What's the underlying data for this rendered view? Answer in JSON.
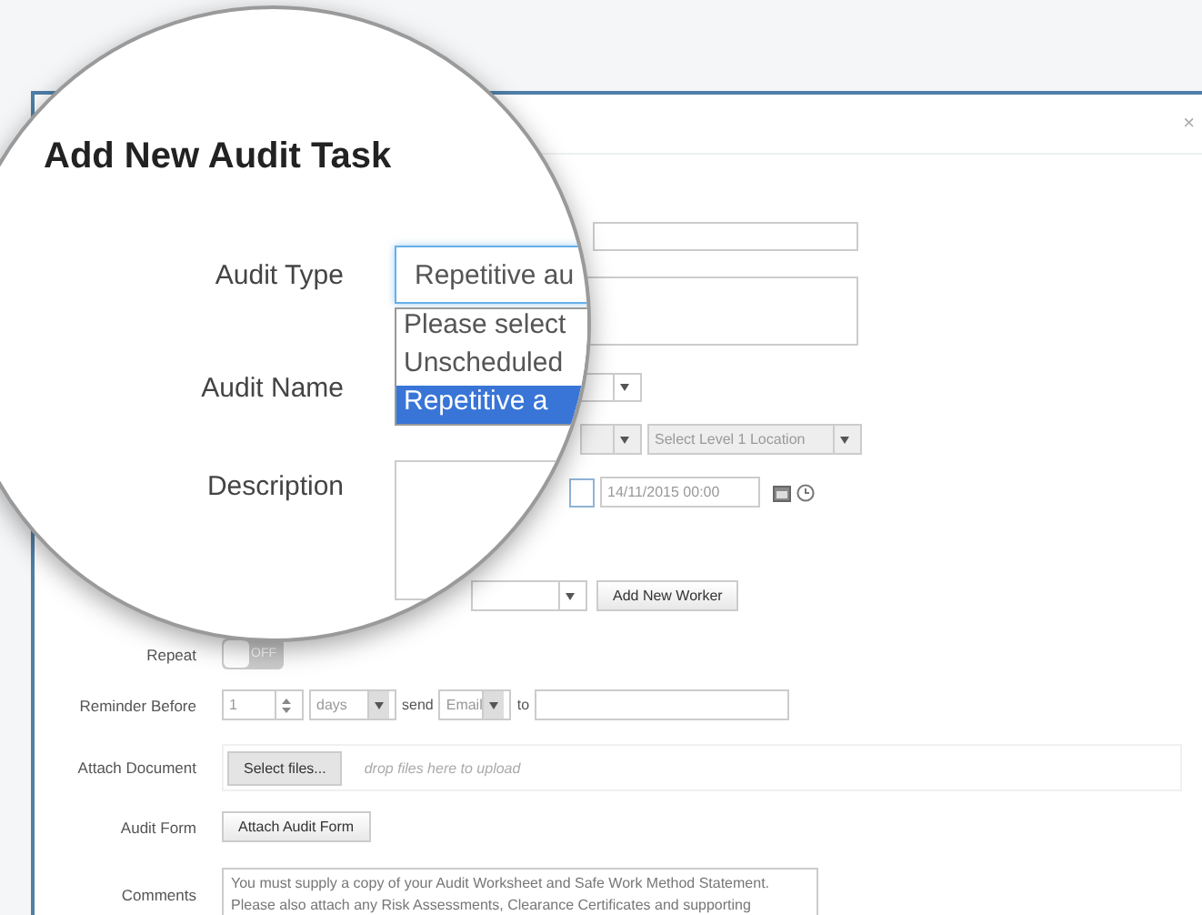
{
  "dialog": {
    "title": "Add New Audit Task",
    "close": "×"
  },
  "magnified": {
    "audit_type": {
      "label": "Audit Type",
      "value": "Repetitive au",
      "expanded": true,
      "options": [
        {
          "label": "Please select",
          "selected": false
        },
        {
          "label": "Unscheduled",
          "selected": false
        },
        {
          "label": "Repetitive a",
          "selected": true
        }
      ]
    },
    "audit_name": {
      "label": "Audit Name"
    },
    "description": {
      "label": "Description"
    }
  },
  "location": {
    "placeholder": "Select Level 1 Location",
    "disabled": true
  },
  "date": {
    "checked": false,
    "value": "14/11/2015 00:00"
  },
  "worker_button": "Add New Worker",
  "repeat": {
    "label": "Repeat",
    "on": false,
    "state_text": "OFF"
  },
  "reminder": {
    "label": "Reminder Before",
    "amount": "1",
    "unit": "days",
    "send": "send",
    "channel": "Email",
    "to": "to"
  },
  "attach": {
    "label": "Attach Document",
    "button": "Select files...",
    "hint": "drop files here to upload"
  },
  "audit_form": {
    "label": "Audit Form",
    "button": "Attach Audit Form"
  },
  "comments": {
    "label": "Comments",
    "value": "You must supply a copy of your Audit Worksheet and Safe Work Method Statement. Please also attach any Risk Assessments, Clearance Certificates and supporting"
  }
}
